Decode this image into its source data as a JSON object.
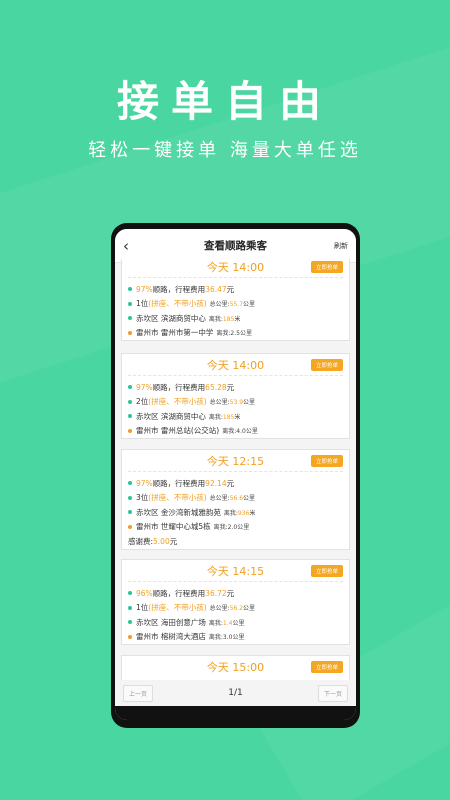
{
  "headline": "接单自由",
  "subline": "轻松一键接单 海量大单任选",
  "navbar": {
    "back": "‹",
    "title": "查看顺路乘客",
    "refresh": "刷新"
  },
  "grab_label": "立即抢单",
  "cards": [
    {
      "time": "今天 14:00",
      "route_pct": "97%",
      "route_text": "顺路，行程费用",
      "fare": "36.47",
      "fare_unit": "元",
      "seats": "1位",
      "carpool": "(拼座、不带小孩)",
      "total_label": "总公里:",
      "total_km": "55.7",
      "km_unit": "公里",
      "pickup": "赤坎区 滨湖商贸中心",
      "pickup_dist_label": "离我:",
      "pickup_dist": "185",
      "pickup_unit": "米",
      "dest": "雷州市 雷州市第一中学",
      "dest_dist": "离我:2.5公里"
    },
    {
      "time": "今天 14:00",
      "route_pct": "97%",
      "route_text": "顺路，行程费用",
      "fare": "65.28",
      "fare_unit": "元",
      "seats": "2位",
      "carpool": "(拼座、不带小孩)",
      "total_label": "总公里:",
      "total_km": "53.9",
      "km_unit": "公里",
      "pickup": "赤坎区 滨湖商贸中心",
      "pickup_dist_label": "离我:",
      "pickup_dist": "185",
      "pickup_unit": "米",
      "dest": "雷州市 雷州总站(公交站)",
      "dest_dist": "离我:4.0公里"
    },
    {
      "time": "今天 12:15",
      "route_pct": "97%",
      "route_text": "顺路，行程费用",
      "fare": "92.14",
      "fare_unit": "元",
      "seats": "3位",
      "carpool": "(拼座、不带小孩)",
      "total_label": "总公里:",
      "total_km": "56.6",
      "km_unit": "公里",
      "pickup": "赤坎区 金沙湾新城雅韵苑",
      "pickup_dist_label": "离我:",
      "pickup_dist": "936",
      "pickup_unit": "米",
      "dest": "雷州市 世耀中心城5栋",
      "dest_dist": "离我:2.0公里",
      "thanks_label": "感谢费:",
      "thanks_value": "5.00",
      "thanks_unit": "元"
    },
    {
      "time": "今天 14:15",
      "route_pct": "96%",
      "route_text": "顺路，行程费用",
      "fare": "36.72",
      "fare_unit": "元",
      "seats": "1位",
      "carpool": "(拼座、不带小孩)",
      "total_label": "总公里:",
      "total_km": "56.2",
      "km_unit": "公里",
      "pickup": "赤坎区 海田创意广场",
      "pickup_dist_label": "离我:",
      "pickup_dist": "1.4",
      "pickup_unit": "公里",
      "dest": "雷州市 榕树湾大酒店",
      "dest_dist": "离我:3.0公里"
    },
    {
      "time": "今天 15:00"
    }
  ],
  "pager": {
    "prev": "上一页",
    "page": "1/1",
    "next": "下一页"
  },
  "colors": {
    "bg": "#49d6a0",
    "accent": "#f5a623",
    "green_dot": "#2cc59a",
    "orange_dot": "#f29a2e"
  }
}
